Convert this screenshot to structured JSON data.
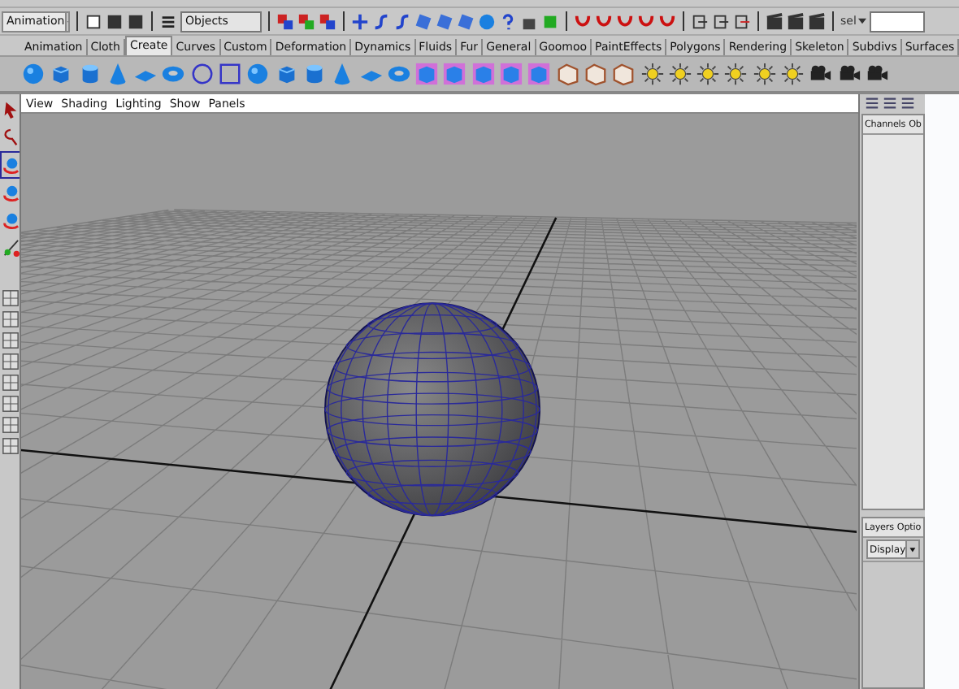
{
  "status_line": {
    "menu_set": "Animation",
    "selection_mask": "Objects",
    "quick_select_label": "sel"
  },
  "shelf_tabs": [
    {
      "label": "Animation",
      "selected": false
    },
    {
      "label": "Cloth",
      "selected": false
    },
    {
      "label": "Create",
      "selected": true
    },
    {
      "label": "Curves",
      "selected": false
    },
    {
      "label": "Custom",
      "selected": false
    },
    {
      "label": "Deformation",
      "selected": false
    },
    {
      "label": "Dynamics",
      "selected": false
    },
    {
      "label": "Fluids",
      "selected": false
    },
    {
      "label": "Fur",
      "selected": false
    },
    {
      "label": "General",
      "selected": false
    },
    {
      "label": "Goomoo",
      "selected": false
    },
    {
      "label": "PaintEffects",
      "selected": false
    },
    {
      "label": "Polygons",
      "selected": false
    },
    {
      "label": "Rendering",
      "selected": false
    },
    {
      "label": "Skeleton",
      "selected": false
    },
    {
      "label": "Subdivs",
      "selected": false
    },
    {
      "label": "Surfaces",
      "selected": false
    }
  ],
  "viewport": {
    "menu": [
      "View",
      "Shading",
      "Lighting",
      "Show",
      "Panels"
    ]
  },
  "channel_box": {
    "tabs": [
      "Channels",
      "Ob"
    ]
  },
  "layer_editor": {
    "tabs": [
      "Layers",
      "Optio"
    ],
    "display_dropdown": "Display"
  }
}
